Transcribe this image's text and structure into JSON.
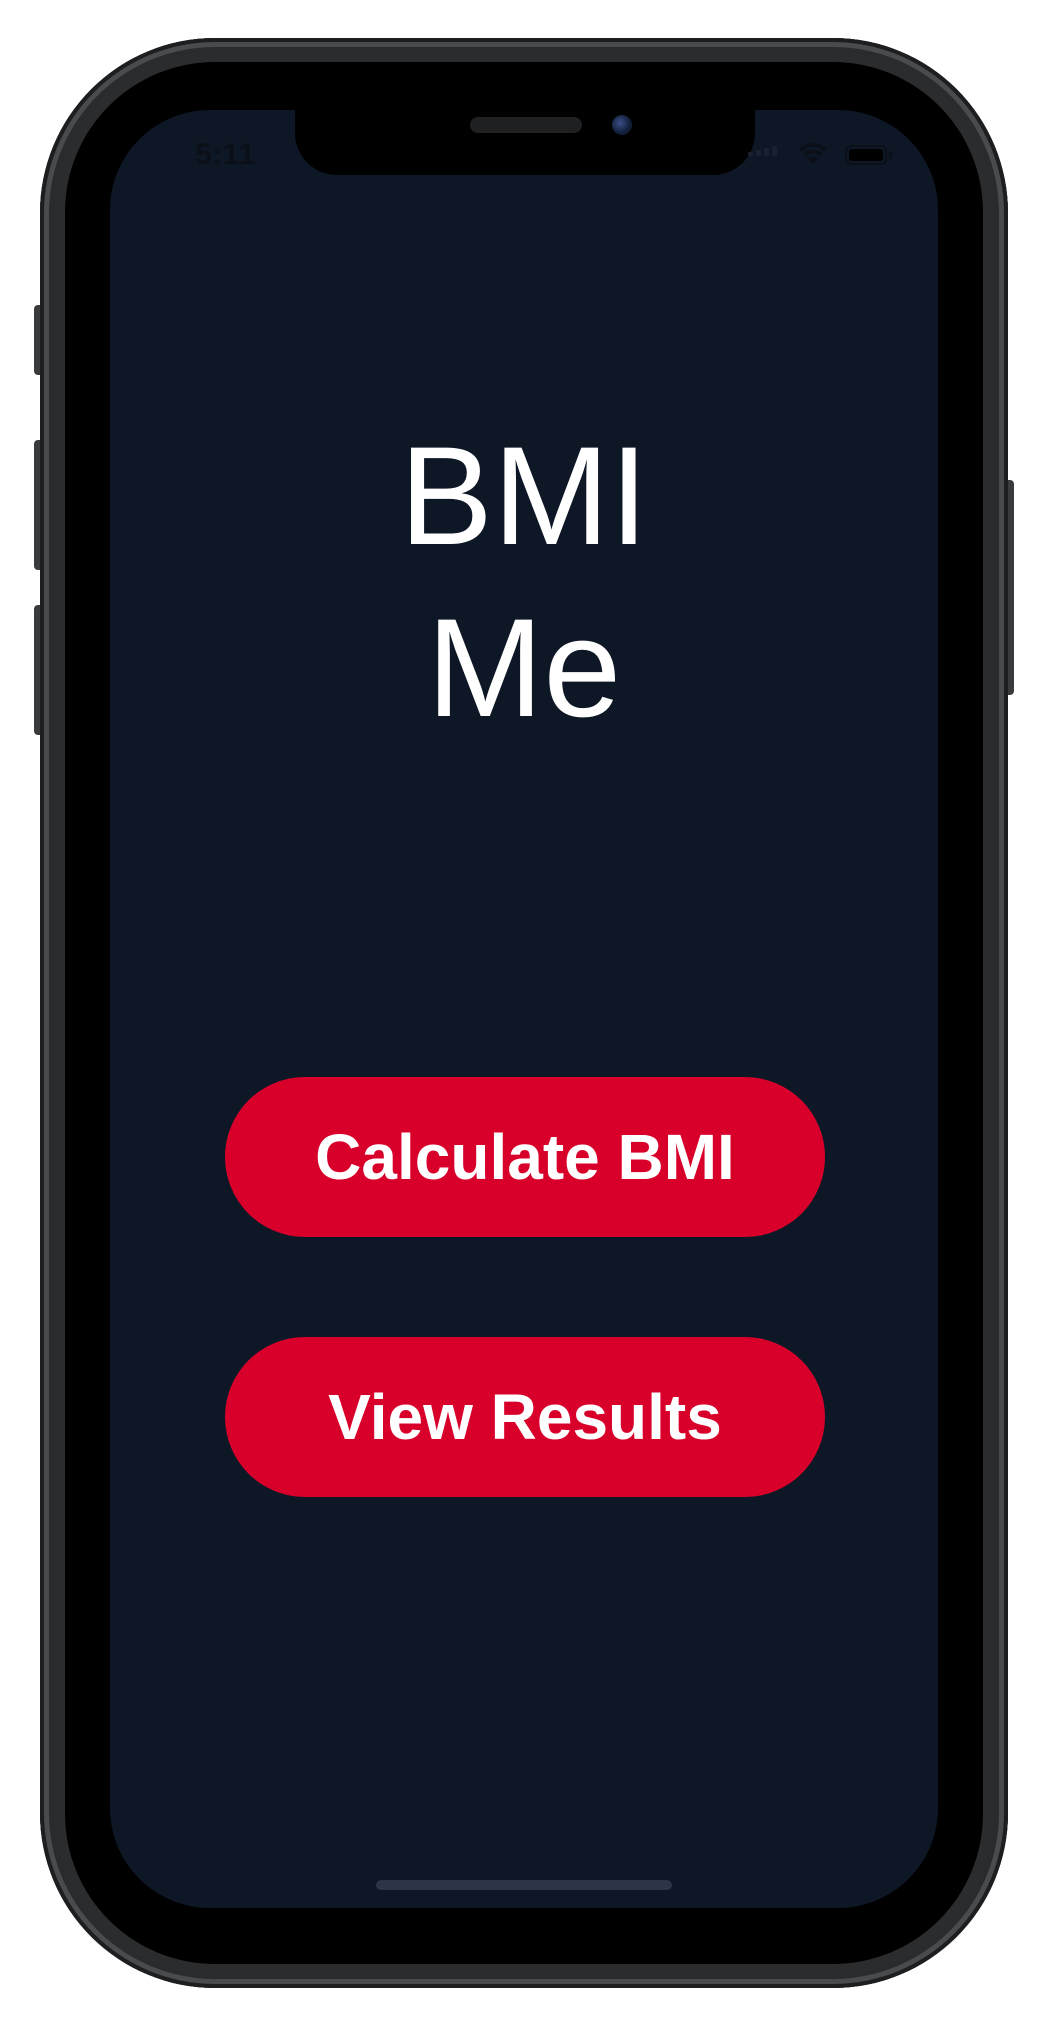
{
  "status_bar": {
    "time": "5:11",
    "signal_icon": "cellular-signal-icon",
    "wifi_icon": "wifi-icon",
    "battery_icon": "battery-icon"
  },
  "app": {
    "title_line1": "BMI",
    "title_line2": "Me"
  },
  "actions": {
    "calculate_label": "Calculate BMI",
    "results_label": "View Results"
  },
  "colors": {
    "background": "#0e1726",
    "accent": "#d8002a",
    "text": "#ffffff"
  }
}
